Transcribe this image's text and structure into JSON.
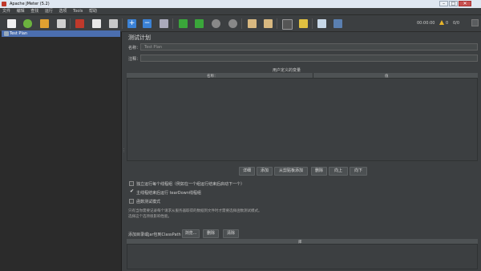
{
  "window": {
    "title": "Apache JMeter (5.2)",
    "minimize": "–",
    "maximize": "□",
    "close": "✕"
  },
  "menu": [
    "文件",
    "编辑",
    "查找",
    "运行",
    "选项",
    "Tools",
    "帮助"
  ],
  "toolbar": {
    "elapsed": "00:00:00",
    "warnings": "0",
    "threads": "0/0",
    "icon_colors": {
      "new": "#f0f0f0",
      "templates": "#6cb33e",
      "open": "#e0a030",
      "save": "#d0d0d0",
      "cut": "#c0392b",
      "copy": "#e8e8e8",
      "paste": "#c8c8c8",
      "expand": "#3b82d6",
      "collapse": "#3b82d6",
      "toggle": "#aab",
      "start": "#3aa63a",
      "start_no_pause": "#3aa63a",
      "stop": "#888888",
      "shutdown": "#888888",
      "clear": "#d8b880",
      "clear_all": "#d8b880",
      "search": "#555555",
      "reset": "#e0c040",
      "function_helper": "#c8d8e8",
      "help": "#5a7fb0"
    }
  },
  "tree": {
    "root_label": "Test Plan"
  },
  "plan": {
    "title": "测试计划",
    "name_label": "名称：",
    "name_value": "Test Plan",
    "comment_label": "注释：",
    "comment_value": "",
    "vars_title": "用户定义的变量",
    "vars_columns": [
      "名称：",
      "值"
    ],
    "vars_rows": [],
    "buttons": [
      "详细",
      "添加",
      "从剪贴板添加",
      "删除",
      "向上",
      "向下"
    ],
    "options": [
      {
        "label": "独立运行每个线程组（例如在一个组运行结束后启动下一个）",
        "checked": false
      },
      {
        "label": "主线程结束后运行 tearDown线程组",
        "checked": true
      },
      {
        "label": "函数测试模式",
        "checked": false
      }
    ],
    "note_line1": "只有当你需要记录每个请求从服务器取得的数据到文件时才需要选择函数测试模式。",
    "note_line2": "选择这个选项很影响性能。",
    "classpath_label": "添加目录或jar包到ClassPath",
    "classpath_buttons": [
      "浏览...",
      "删除",
      "清除"
    ],
    "classpath_column": "库"
  }
}
